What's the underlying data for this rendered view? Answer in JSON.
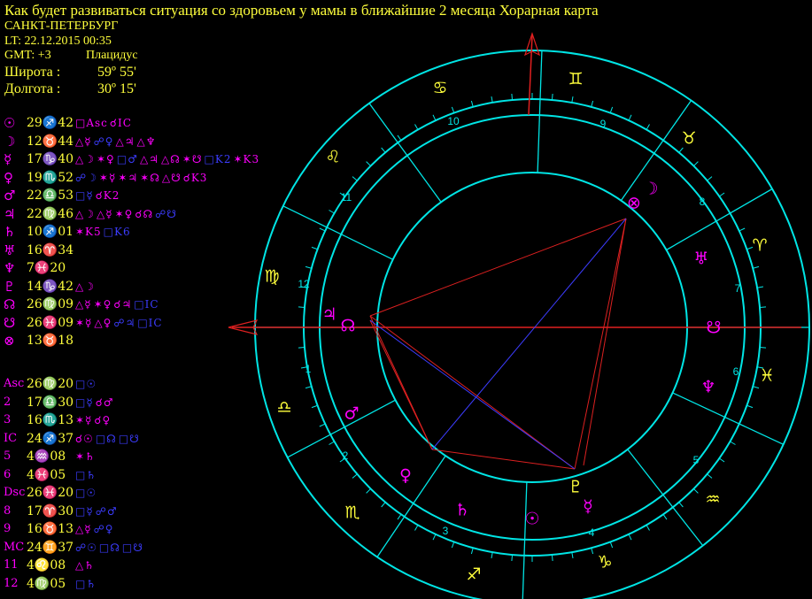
{
  "header": {
    "title": "Как будет развиваться ситуация со здоровьем у мамы в ближайшие 2 месяца Хорарная карта",
    "city": "САНКТ-ПЕТЕРБУРГ",
    "lt": "LT: 22.12.2015  00:35",
    "gmt": "GMT: +3",
    "house_system": "Плацидус",
    "lat_label": "Широта :",
    "lat_value": "59º 55'",
    "lon_label": "Долгота :",
    "lon_value": "30º 15'"
  },
  "colors": {
    "background": "#000000",
    "text_yellow": "#ffff3c",
    "aspect_magenta": "#ff00ff",
    "aspect_blue": "#3c3cff",
    "ring_cyan": "#00e5e5",
    "aspect_red": "#dd2020",
    "axis_red": "#e02020"
  },
  "planets": [
    {
      "icon": "sun-icon",
      "sym": "☉",
      "pos": "29♐42",
      "color": "#ff00ff",
      "aspects": [
        {
          "t": "□Asc",
          "c": "#ff00ff"
        },
        {
          "t": "☌IC",
          "c": "#ff00ff"
        }
      ]
    },
    {
      "icon": "moon-icon",
      "sym": "☽",
      "pos": "12♉44",
      "color": "#ff00ff",
      "aspects": [
        {
          "t": "△☿",
          "c": "#ff00ff"
        },
        {
          "t": "☍♀",
          "c": "#3c3cff"
        },
        {
          "t": "△♃",
          "c": "#ff00ff"
        },
        {
          "t": "△♆",
          "c": "#ff00ff"
        }
      ]
    },
    {
      "icon": "mercury-icon",
      "sym": "☿",
      "pos": "17♑40",
      "color": "#ff00ff",
      "aspects": [
        {
          "t": "△☽",
          "c": "#ff00ff"
        },
        {
          "t": "✶♀",
          "c": "#ff00ff"
        },
        {
          "t": "□♂",
          "c": "#3c3cff"
        },
        {
          "t": "△♃",
          "c": "#ff00ff"
        },
        {
          "t": "△☊",
          "c": "#ff00ff"
        },
        {
          "t": "✶☋",
          "c": "#ff00ff"
        },
        {
          "t": "□K2",
          "c": "#3c3cff"
        },
        {
          "t": "✶K3",
          "c": "#ff00ff"
        }
      ]
    },
    {
      "icon": "venus-icon",
      "sym": "♀",
      "pos": "19♏52",
      "color": "#ff00ff",
      "aspects": [
        {
          "t": "☍☽",
          "c": "#3c3cff"
        },
        {
          "t": "✶☿",
          "c": "#ff00ff"
        },
        {
          "t": "✶♃",
          "c": "#ff00ff"
        },
        {
          "t": "✶☊",
          "c": "#ff00ff"
        },
        {
          "t": "△☋",
          "c": "#ff00ff"
        },
        {
          "t": "☌K3",
          "c": "#ff00ff"
        }
      ]
    },
    {
      "icon": "mars-icon",
      "sym": "♂",
      "pos": "22♎53",
      "color": "#ff00ff",
      "aspects": [
        {
          "t": "□☿",
          "c": "#3c3cff"
        },
        {
          "t": "☌K2",
          "c": "#ff00ff"
        }
      ]
    },
    {
      "icon": "jupiter-icon",
      "sym": "♃",
      "pos": "22♍46",
      "color": "#ff00ff",
      "aspects": [
        {
          "t": "△☽",
          "c": "#ff00ff"
        },
        {
          "t": "△☿",
          "c": "#ff00ff"
        },
        {
          "t": "✶♀",
          "c": "#ff00ff"
        },
        {
          "t": "☌☊",
          "c": "#ff00ff"
        },
        {
          "t": "☍☋",
          "c": "#3c3cff"
        }
      ]
    },
    {
      "icon": "saturn-icon",
      "sym": "♄",
      "pos": "10♐01",
      "color": "#ff00ff",
      "aspects": [
        {
          "t": "✶K5",
          "c": "#ff00ff"
        },
        {
          "t": "□K6",
          "c": "#3c3cff"
        }
      ]
    },
    {
      "icon": "uranus-icon",
      "sym": "♅",
      "pos": "16♈34",
      "color": "#ff00ff",
      "aspects": []
    },
    {
      "icon": "neptune-icon",
      "sym": "♆",
      "pos": "7♓20",
      "color": "#ff00ff",
      "aspects": []
    },
    {
      "icon": "pluto-icon",
      "sym": "♇",
      "pos": "14♑42",
      "color": "#ff00ff",
      "aspects": [
        {
          "t": "△☽",
          "c": "#ff00ff"
        }
      ]
    },
    {
      "icon": "north-node-icon",
      "sym": "☊",
      "pos": "26♍09",
      "color": "#ff00ff",
      "aspects": [
        {
          "t": "△☿",
          "c": "#ff00ff"
        },
        {
          "t": "✶♀",
          "c": "#ff00ff"
        },
        {
          "t": "☌♃",
          "c": "#ff00ff"
        },
        {
          "t": "□IC",
          "c": "#3c3cff"
        }
      ]
    },
    {
      "icon": "south-node-icon",
      "sym": "☋",
      "pos": "26♓09",
      "color": "#ff00ff",
      "aspects": [
        {
          "t": "✶☿",
          "c": "#ff00ff"
        },
        {
          "t": "△♀",
          "c": "#ff00ff"
        },
        {
          "t": "☍♃",
          "c": "#3c3cff"
        },
        {
          "t": "□IC",
          "c": "#3c3cff"
        }
      ]
    },
    {
      "icon": "part-of-fortune-icon",
      "sym": "⊗",
      "pos": "13♉18",
      "color": "#ff00ff",
      "aspects": []
    }
  ],
  "houses": [
    {
      "sym": "Asc",
      "pos": "26♍20",
      "aspects": [
        {
          "t": "□☉",
          "c": "#3c3cff"
        }
      ]
    },
    {
      "sym": "2",
      "pos": "17♎30",
      "aspects": [
        {
          "t": "□☿",
          "c": "#3c3cff"
        },
        {
          "t": "☌♂",
          "c": "#ff00ff"
        }
      ]
    },
    {
      "sym": "3",
      "pos": "16♏13",
      "aspects": [
        {
          "t": "✶☿",
          "c": "#ff00ff"
        },
        {
          "t": "☌♀",
          "c": "#ff00ff"
        }
      ]
    },
    {
      "sym": "IC",
      "pos": "24♐37",
      "aspects": [
        {
          "t": "☌☉",
          "c": "#ff00ff"
        },
        {
          "t": "□☊",
          "c": "#3c3cff"
        },
        {
          "t": "□☋",
          "c": "#3c3cff"
        }
      ]
    },
    {
      "sym": "5",
      "pos": "4♒08",
      "aspects": [
        {
          "t": "✶♄",
          "c": "#ff00ff"
        }
      ]
    },
    {
      "sym": "6",
      "pos": "4♓05",
      "aspects": [
        {
          "t": "□♄",
          "c": "#3c3cff"
        }
      ]
    },
    {
      "sym": "Dsc",
      "pos": "26♓20",
      "aspects": [
        {
          "t": "□☉",
          "c": "#3c3cff"
        }
      ]
    },
    {
      "sym": "8",
      "pos": "17♈30",
      "aspects": [
        {
          "t": "□☿",
          "c": "#3c3cff"
        },
        {
          "t": "☍♂",
          "c": "#3c3cff"
        }
      ]
    },
    {
      "sym": "9",
      "pos": "16♉13",
      "aspects": [
        {
          "t": "△☿",
          "c": "#ff00ff"
        },
        {
          "t": "☍♀",
          "c": "#3c3cff"
        }
      ]
    },
    {
      "sym": "MC",
      "pos": "24♊37",
      "aspects": [
        {
          "t": "☍☉",
          "c": "#3c3cff"
        },
        {
          "t": "□☊",
          "c": "#3c3cff"
        },
        {
          "t": "□☋",
          "c": "#3c3cff"
        }
      ]
    },
    {
      "sym": "11",
      "pos": "4♌08",
      "aspects": [
        {
          "t": "△♄",
          "c": "#ff00ff"
        }
      ]
    },
    {
      "sym": "12",
      "pos": "4♍05",
      "aspects": [
        {
          "t": "□♄",
          "c": "#3c3cff"
        }
      ]
    }
  ],
  "wheel": {
    "zodiac_signs": [
      {
        "name": "aries-icon",
        "sym": "♈",
        "deg": 0
      },
      {
        "name": "taurus-icon",
        "sym": "♉",
        "deg": 30
      },
      {
        "name": "gemini-icon",
        "sym": "♊",
        "deg": 60
      },
      {
        "name": "cancer-icon",
        "sym": "♋",
        "deg": 90
      },
      {
        "name": "leo-icon",
        "sym": "♌",
        "deg": 120
      },
      {
        "name": "virgo-icon",
        "sym": "♍",
        "deg": 150
      },
      {
        "name": "libra-icon",
        "sym": "♎",
        "deg": 180
      },
      {
        "name": "scorpio-icon",
        "sym": "♏",
        "deg": 210
      },
      {
        "name": "sagittarius-icon",
        "sym": "♐",
        "deg": 240
      },
      {
        "name": "capricorn-icon",
        "sym": "♑",
        "deg": 270
      },
      {
        "name": "aquarius-icon",
        "sym": "♒",
        "deg": 300
      },
      {
        "name": "pisces-icon",
        "sym": "♓",
        "deg": 330
      }
    ],
    "house_numbers": [
      "1",
      "2",
      "3",
      "4",
      "5",
      "6",
      "7",
      "8",
      "9",
      "10",
      "11",
      "12"
    ],
    "planet_glyphs": [
      {
        "name": "fortune-glyph",
        "sym": "⊗",
        "color": "#ff00ff"
      },
      {
        "name": "moon-glyph",
        "sym": "☽",
        "color": "#ff00ff"
      },
      {
        "name": "uranus-glyph",
        "sym": "♅",
        "color": "#ff00ff"
      },
      {
        "name": "south-node-glyph",
        "sym": "☋",
        "color": "#ff00ff"
      },
      {
        "name": "neptune-glyph",
        "sym": "♆",
        "color": "#ff00ff"
      },
      {
        "name": "pluto-glyph",
        "sym": "♇",
        "color": "#ffff3c"
      },
      {
        "name": "mercury-glyph",
        "sym": "☿",
        "color": "#ff00ff"
      },
      {
        "name": "sun-glyph",
        "sym": "☉",
        "color": "#ff00ff"
      },
      {
        "name": "saturn-glyph",
        "sym": "♄",
        "color": "#ff00ff"
      },
      {
        "name": "venus-glyph",
        "sym": "♀",
        "color": "#ff00ff"
      },
      {
        "name": "mars-glyph",
        "sym": "♂",
        "color": "#ff00ff"
      },
      {
        "name": "jupiter-glyph",
        "sym": "♃",
        "color": "#ff00ff"
      },
      {
        "name": "north-node-glyph",
        "sym": "☊",
        "color": "#ff00ff"
      }
    ]
  }
}
